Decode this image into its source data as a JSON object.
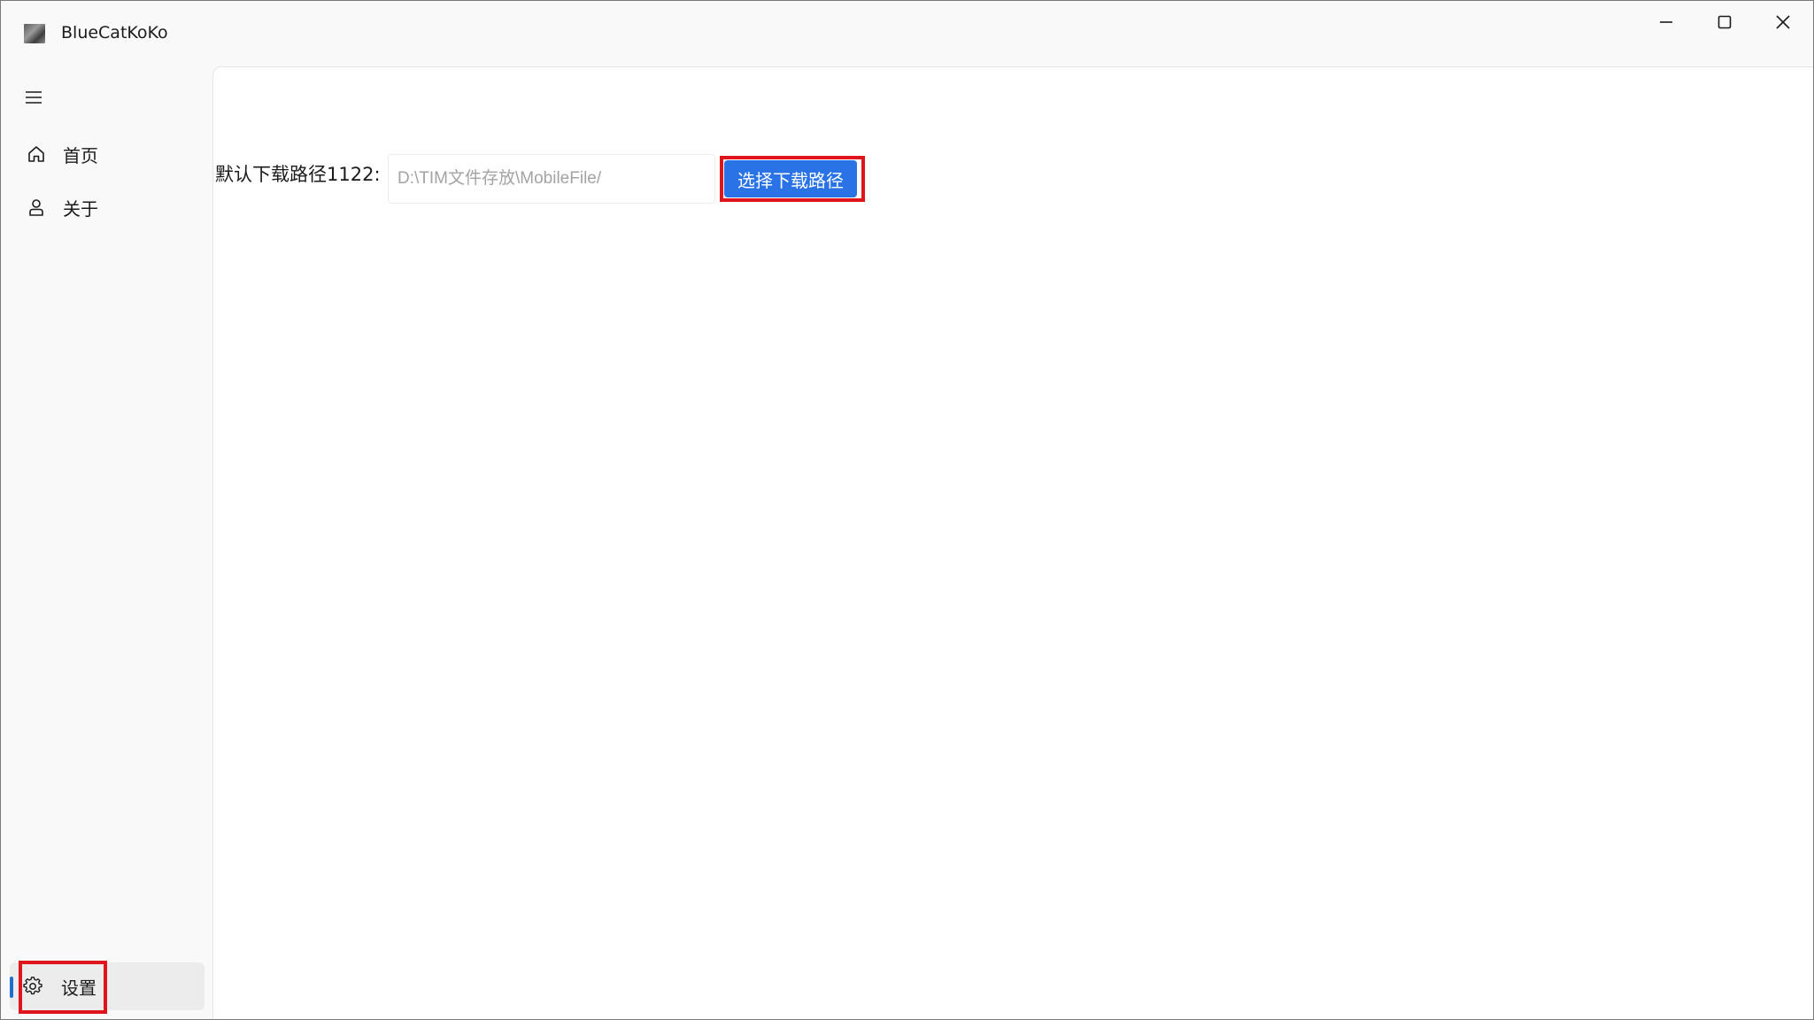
{
  "window": {
    "title": "BlueCatKoKo",
    "controls": {
      "minimize": "minimize-icon",
      "maximize": "maximize-icon",
      "close": "close-icon"
    }
  },
  "sidebar": {
    "menu_icon": "hamburger-menu-icon",
    "items": [
      {
        "label": "首页",
        "icon": "home-icon"
      },
      {
        "label": "关于",
        "icon": "person-icon"
      }
    ],
    "footer_items": [
      {
        "label": "设置",
        "icon": "gear-icon",
        "selected": true
      }
    ]
  },
  "settings": {
    "download_path_label": "默认下载路径1122:",
    "download_path_placeholder": "D:\\TIM文件存放\\MobileFile/",
    "choose_path_button": "选择下载路径"
  },
  "colors": {
    "accent": "#2a73e6",
    "selection_indicator": "#1f6fd1",
    "highlight": "#e0141c"
  }
}
